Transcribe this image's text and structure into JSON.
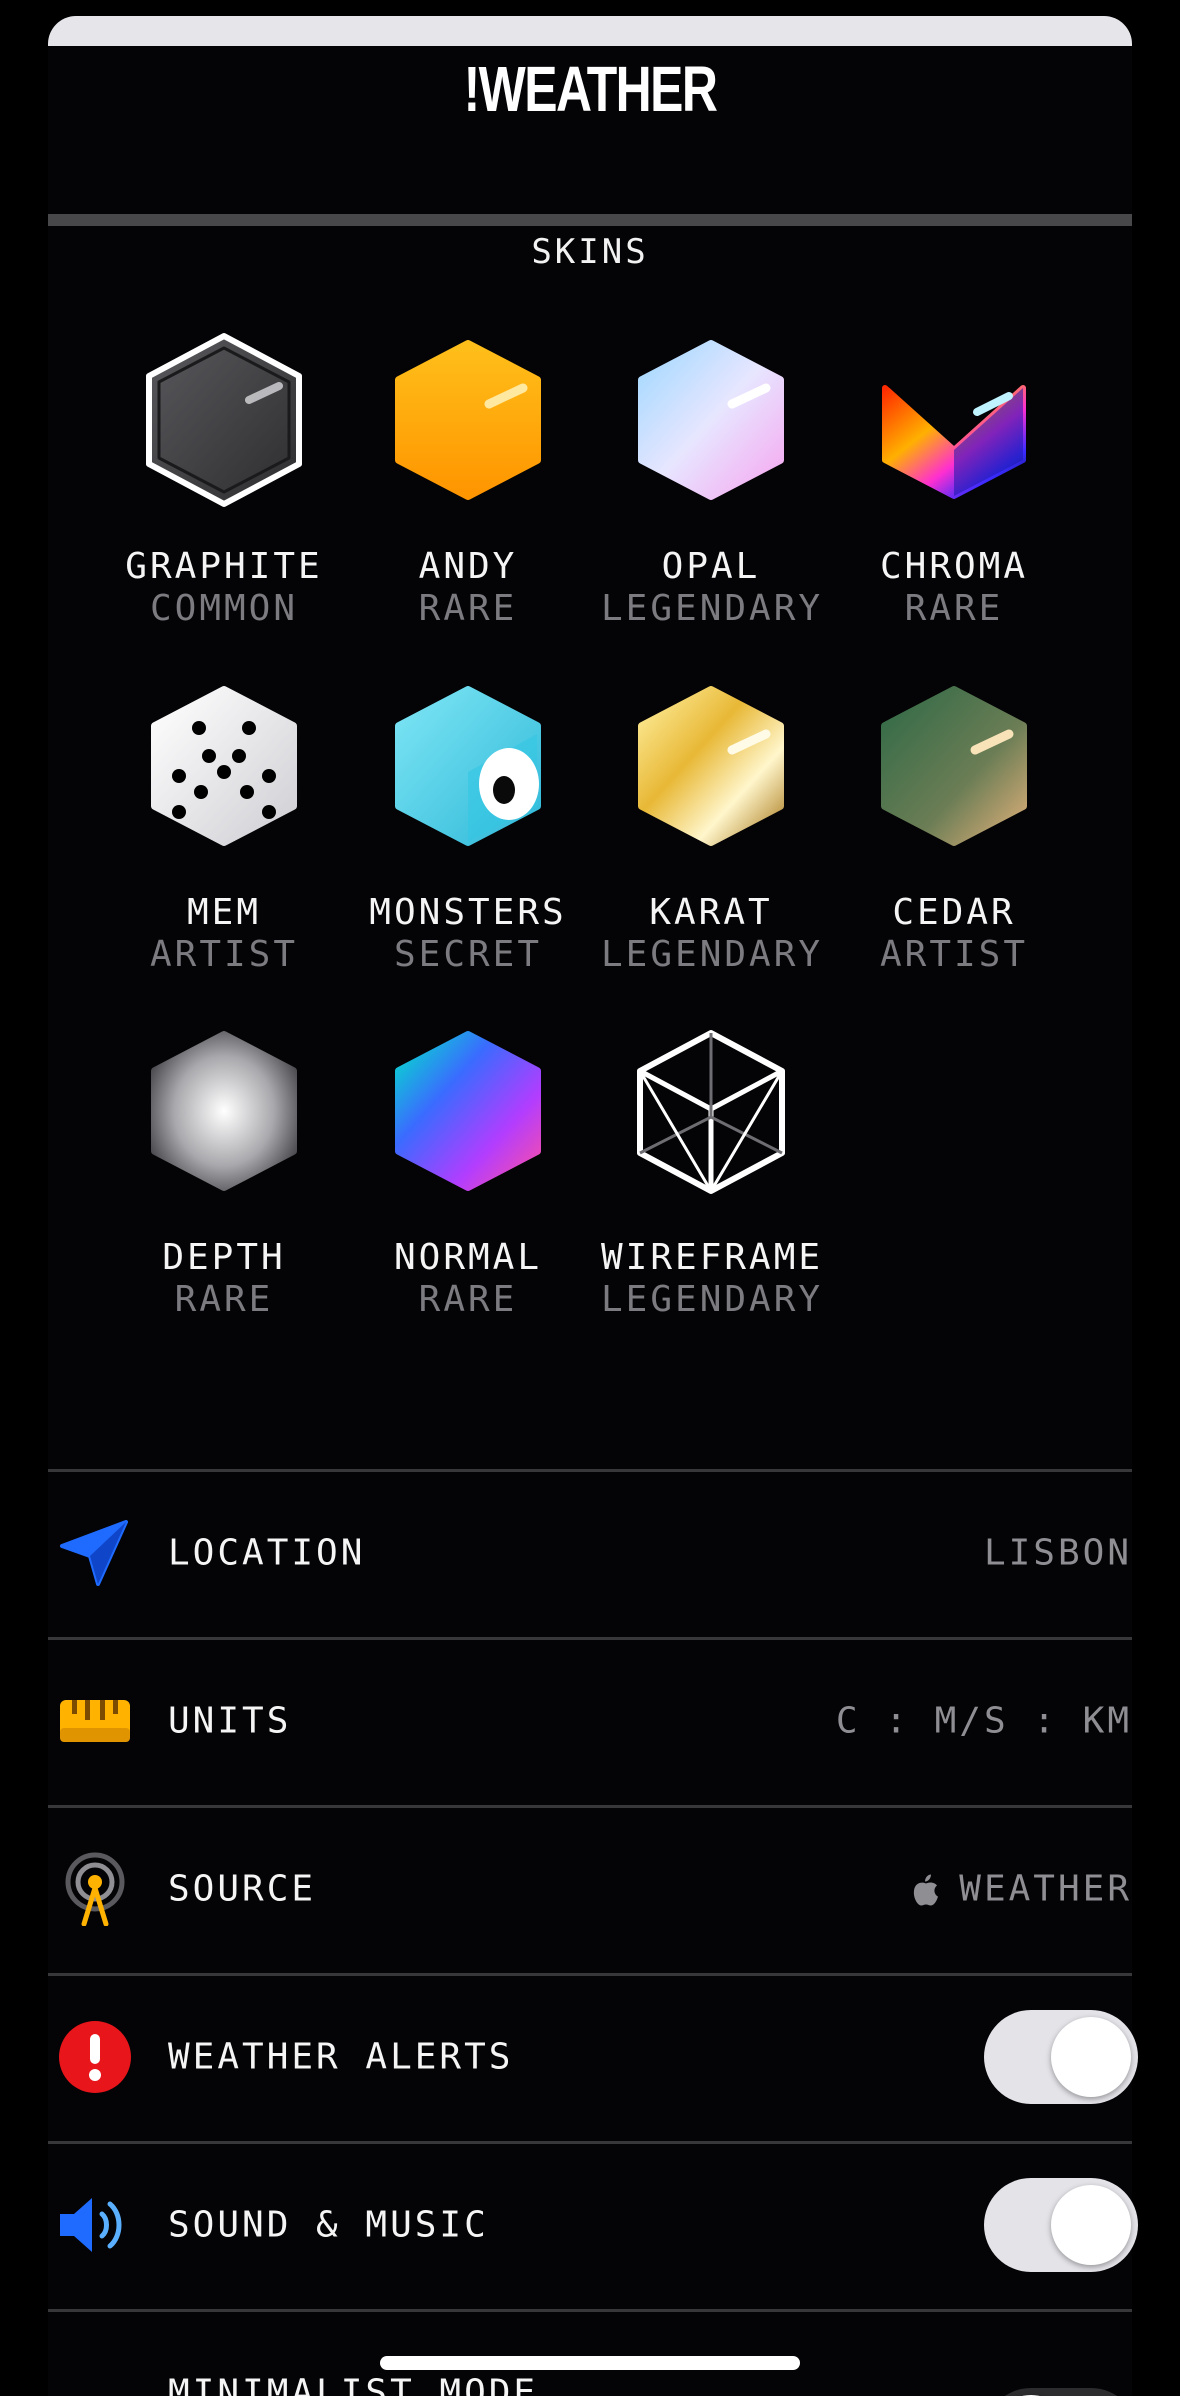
{
  "app": {
    "title": "!WEATHER"
  },
  "skins_section": {
    "title": "SKINS",
    "items": [
      {
        "name": "GRAPHITE",
        "rarity": "COMMON",
        "icon": "graphite-cube-icon"
      },
      {
        "name": "ANDY",
        "rarity": "RARE",
        "icon": "andy-cube-icon"
      },
      {
        "name": "OPAL",
        "rarity": "LEGENDARY",
        "icon": "opal-cube-icon"
      },
      {
        "name": "CHROMA",
        "rarity": "RARE",
        "icon": "chroma-cube-icon"
      },
      {
        "name": "MEM",
        "rarity": "ARTIST",
        "icon": "mem-dice-cube-icon"
      },
      {
        "name": "MONSTERS",
        "rarity": "SECRET",
        "icon": "monsters-cube-icon"
      },
      {
        "name": "KARAT",
        "rarity": "LEGENDARY",
        "icon": "karat-gold-cube-icon"
      },
      {
        "name": "CEDAR",
        "rarity": "ARTIST",
        "icon": "cedar-cube-icon"
      },
      {
        "name": "DEPTH",
        "rarity": "RARE",
        "icon": "depth-cube-icon"
      },
      {
        "name": "NORMAL",
        "rarity": "RARE",
        "icon": "normal-cube-icon"
      },
      {
        "name": "WIREFRAME",
        "rarity": "LEGENDARY",
        "icon": "wireframe-cube-icon"
      }
    ],
    "selected": "GRAPHITE"
  },
  "settings": [
    {
      "label": "LOCATION",
      "value": "LISBON",
      "icon": "location-arrow-icon"
    },
    {
      "label": "UNITS",
      "value": "C : M/S : KM",
      "icon": "ruler-icon"
    },
    {
      "label": "SOURCE",
      "value": "WEATHER",
      "icon": "antenna-icon",
      "value_icon": "apple-logo-icon"
    },
    {
      "label": "WEATHER ALERTS",
      "toggle": true,
      "icon": "alert-icon"
    },
    {
      "label": "SOUND & MUSIC",
      "toggle": true,
      "icon": "speaker-icon"
    },
    {
      "label": "MINIMALIST MODE",
      "toggle": false,
      "icon": "minimalist-icon"
    }
  ],
  "colors": {
    "background": "#000000",
    "accent_blue": "#1f6bff",
    "accent_orange": "#ffb300",
    "alert_red": "#e8151b",
    "muted_text": "#7b7b80"
  }
}
